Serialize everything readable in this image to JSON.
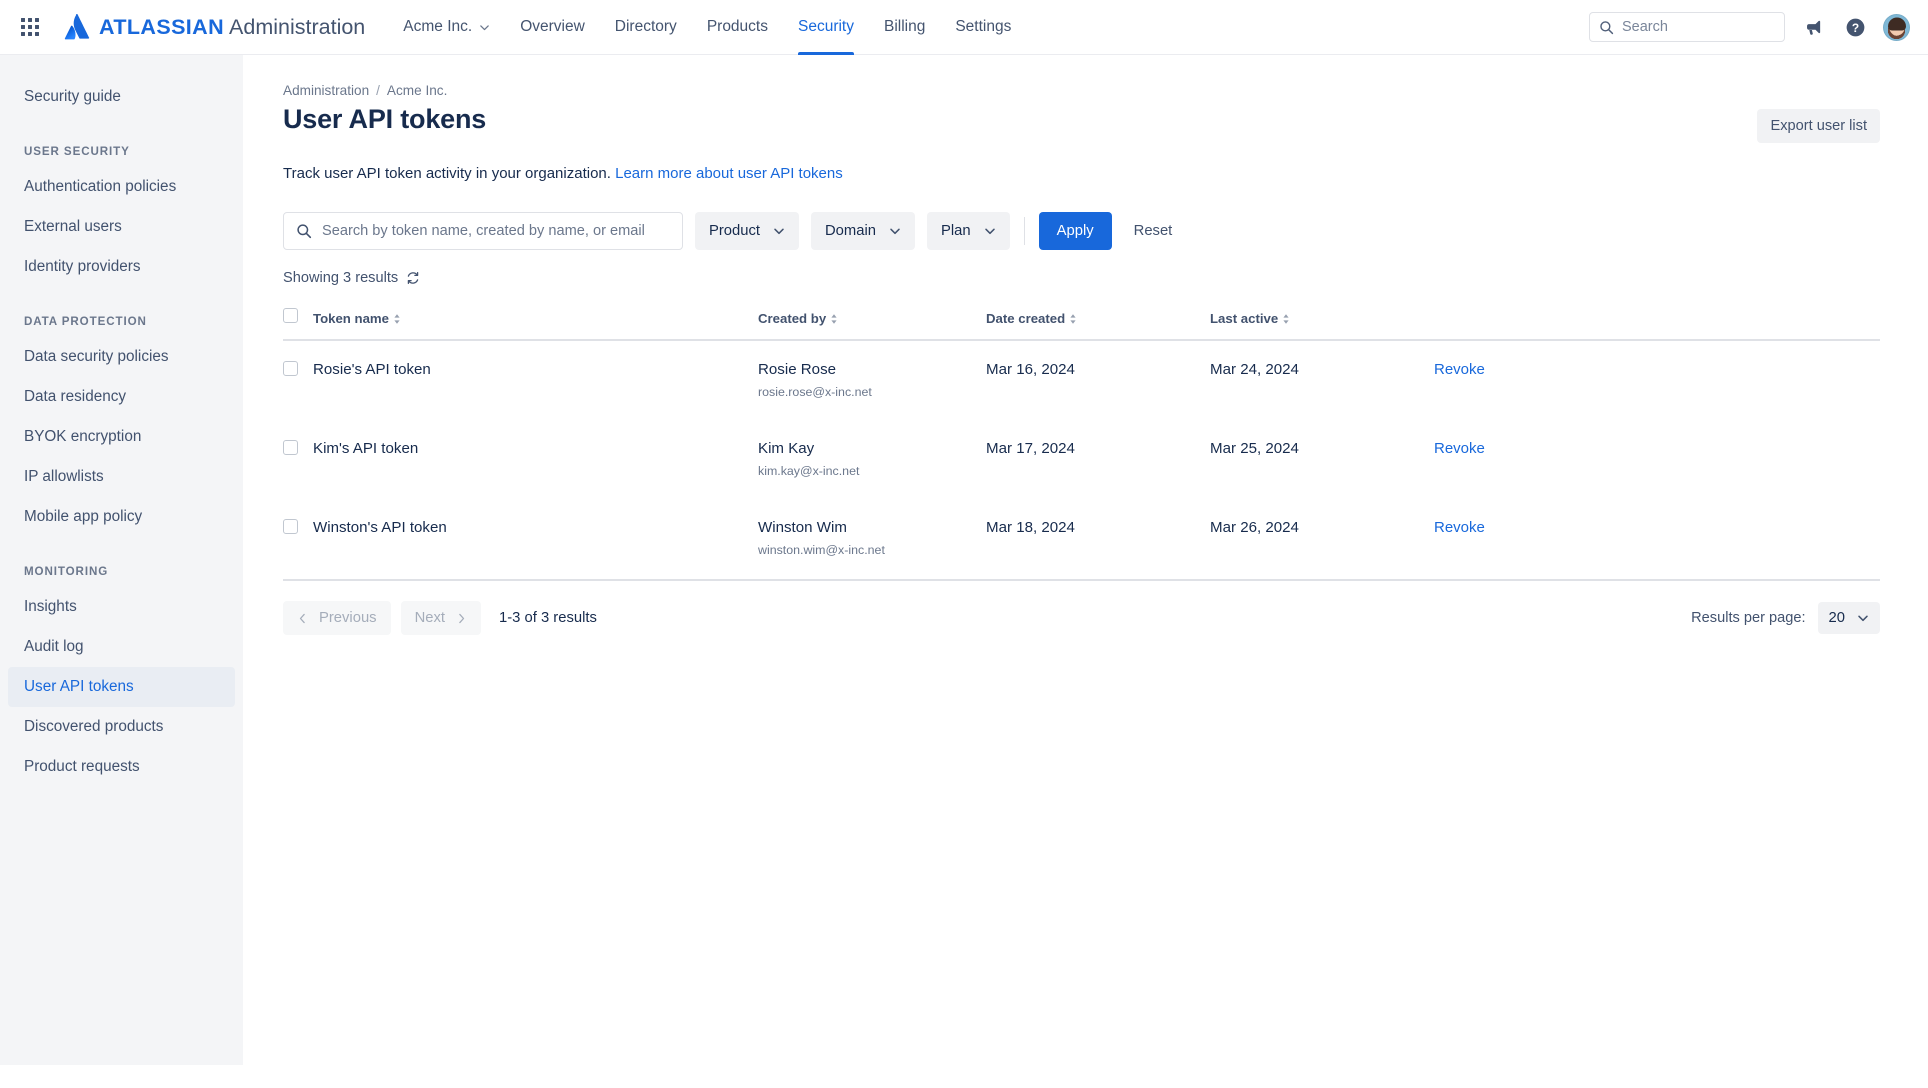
{
  "topnav": {
    "app_switcher_icon": "grid-apps-icon",
    "brand_bold": "ATLASSIAN",
    "brand_regular": "Administration",
    "org_switcher": "Acme Inc.",
    "links": [
      {
        "label": "Overview",
        "active": false
      },
      {
        "label": "Directory",
        "active": false
      },
      {
        "label": "Products",
        "active": false
      },
      {
        "label": "Security",
        "active": true
      },
      {
        "label": "Billing",
        "active": false
      },
      {
        "label": "Settings",
        "active": false
      }
    ],
    "search_placeholder": "Search",
    "search_value": "",
    "notifications_icon": "megaphone-icon",
    "help_icon": "help-question-icon",
    "avatar_label": "profile-avatar",
    "accent_color": "#1868db"
  },
  "sidebar": {
    "top_items": [
      {
        "label": "Security guide",
        "active": false
      }
    ],
    "sections": [
      {
        "heading": "USER SECURITY",
        "items": [
          {
            "label": "Authentication policies",
            "active": false
          },
          {
            "label": "External users",
            "active": false
          },
          {
            "label": "Identity providers",
            "active": false
          }
        ]
      },
      {
        "heading": "DATA PROTECTION",
        "items": [
          {
            "label": "Data security policies",
            "active": false
          },
          {
            "label": "Data residency",
            "active": false
          },
          {
            "label": "BYOK encryption",
            "active": false
          },
          {
            "label": "IP allowlists",
            "active": false
          },
          {
            "label": "Mobile app policy",
            "active": false
          }
        ]
      },
      {
        "heading": "MONITORING",
        "items": [
          {
            "label": "Insights",
            "active": false
          },
          {
            "label": "Audit log",
            "active": false
          },
          {
            "label": "User API tokens",
            "active": true
          },
          {
            "label": "Discovered products",
            "active": false
          },
          {
            "label": "Product requests",
            "active": false
          }
        ]
      }
    ]
  },
  "breadcrumb": {
    "root": "Administration",
    "separator": "/",
    "org": "Acme Inc."
  },
  "header": {
    "title": "User API tokens",
    "export_button": "Export user list",
    "description": "Track user API token activity in your organization.",
    "learn_more_link": "Learn more about user API tokens"
  },
  "filters": {
    "search_placeholder": "Search by token name, created by name, or email",
    "search_value": "",
    "search_icon": "search-icon",
    "dropdowns": [
      {
        "label": "Product"
      },
      {
        "label": "Domain"
      },
      {
        "label": "Plan"
      }
    ],
    "apply_button": "Apply",
    "reset_button": "Reset",
    "showing_text": "Showing 3 results",
    "refresh_icon": "refresh-icon"
  },
  "table": {
    "columns": [
      {
        "key": "token",
        "label": "Token name",
        "sortable": true
      },
      {
        "key": "created_by",
        "label": "Created by",
        "sortable": true
      },
      {
        "key": "date_created",
        "label": "Date created",
        "sortable": true
      },
      {
        "key": "last_active",
        "label": "Last active",
        "sortable": true
      },
      {
        "key": "action",
        "label": "",
        "sortable": false
      }
    ],
    "rows": [
      {
        "token": "Rosie's API token",
        "created_by_name": "Rosie Rose",
        "created_by_email": "rosie.rose@x-inc.net",
        "date_created": "Mar 16, 2024",
        "last_active": "Mar 24, 2024",
        "action": "Revoke"
      },
      {
        "token": "Kim's API token",
        "created_by_name": "Kim Kay",
        "created_by_email": "kim.kay@x-inc.net",
        "date_created": "Mar 17, 2024",
        "last_active": "Mar 25, 2024",
        "action": "Revoke"
      },
      {
        "token": "Winston's API token",
        "created_by_name": "Winston Wim",
        "created_by_email": "winston.wim@x-inc.net",
        "date_created": "Mar 18, 2024",
        "last_active": "Mar 26, 2024",
        "action": "Revoke"
      }
    ]
  },
  "pagination": {
    "previous": "Previous",
    "next": "Next",
    "range_text": "1-3 of 3 results",
    "results_per_page_label": "Results per page:",
    "results_per_page_value": "20"
  }
}
